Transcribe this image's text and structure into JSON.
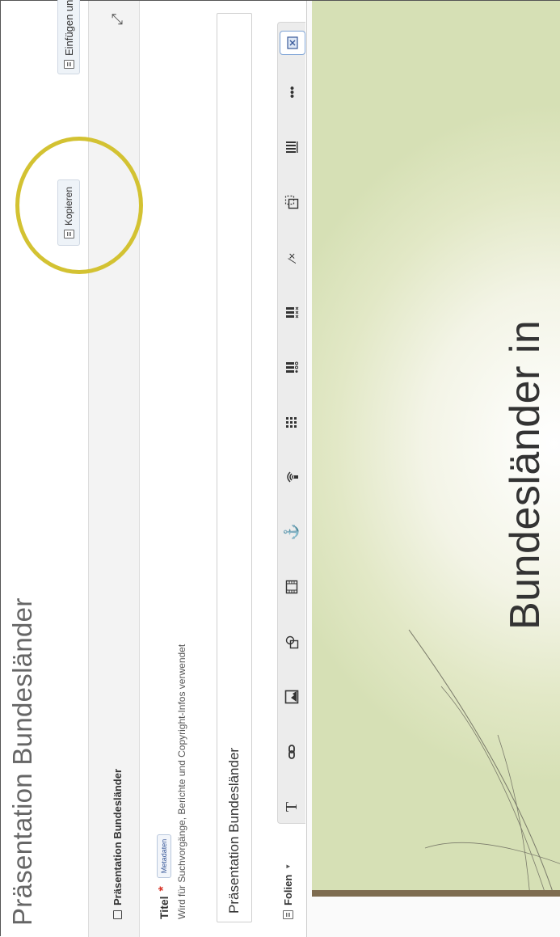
{
  "page": {
    "title": "Präsentation Bundesländer"
  },
  "breadcrumb": {
    "label": "Präsentation Bundesländer"
  },
  "actions": {
    "copy_label": "Kopieren",
    "insert_label": "Einfügen und Ersetzen"
  },
  "form": {
    "title_label": "Titel",
    "required_mark": "*",
    "metadata_tag": "Metadaten",
    "hint": "Wird für Suchvorgänge, Berichte und Copyright-Infos verwendet",
    "title_value": "Präsentation Bundesländer"
  },
  "toolbar": {
    "folien_label": "Folien",
    "text_tool": "T",
    "tools": [
      "text-icon",
      "link-icon",
      "image-icon",
      "shape-icon",
      "video-icon",
      "anchor-icon",
      "audio-icon",
      "grid-icon",
      "poll-icon",
      "list-check-icon",
      "fraction-icon",
      "resize-icon",
      "bars-icon",
      "more-icon",
      "close-icon"
    ]
  },
  "slide": {
    "title": "Bundesländer in"
  },
  "colors": {
    "highlight": "#d3c232",
    "accent": "#7fa4d6",
    "slide_bar": "#7e6c50"
  }
}
